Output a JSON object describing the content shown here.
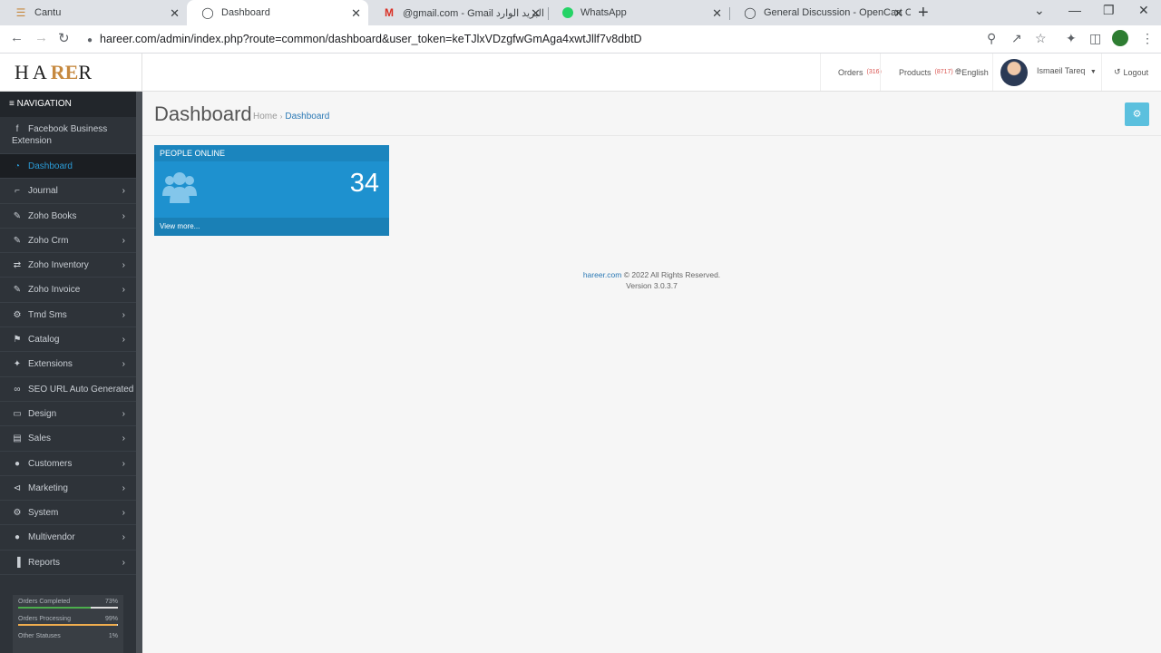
{
  "browser": {
    "tabs": [
      {
        "title": "Cantu",
        "icon": "cantu-favicon"
      },
      {
        "title": "Dashboard",
        "icon": "globe-icon",
        "active": true
      },
      {
        "title": "‎@gmail.com - Gmail البريد الوارد",
        "icon": "gmail-icon"
      },
      {
        "title": "WhatsApp",
        "icon": "whatsapp-icon"
      },
      {
        "title": "General Discussion - OpenCart C",
        "icon": "globe-icon"
      }
    ],
    "url": "hareer.com/admin/index.php?route=common/dashboard&user_token=keTJlxVDzgfwGmAga4xwtJllf7v8dbtD"
  },
  "header": {
    "logo_text_left": "HA",
    "logo_mark": "RE",
    "logo_text_right": "R",
    "orders_label": "Orders",
    "orders_count": "(316)",
    "products_label": "Products",
    "products_count": "(8717)",
    "language": "English",
    "user_name": "Ismaeil Tareq",
    "logout_label": "Logout"
  },
  "sidebar": {
    "heading": "NAVIGATION",
    "items": [
      {
        "label": "Facebook Business Extension",
        "icon": "facebook-icon"
      },
      {
        "label": "Dashboard",
        "icon": "dashboard-icon",
        "active": true
      },
      {
        "label": "Journal",
        "icon": "journal-icon",
        "submenu": true
      },
      {
        "label": "Zoho Books",
        "icon": "brush-icon",
        "submenu": true
      },
      {
        "label": "Zoho Crm",
        "icon": "brush-icon",
        "submenu": true
      },
      {
        "label": "Zoho Inventory",
        "icon": "exchange-icon",
        "submenu": true
      },
      {
        "label": "Zoho Invoice",
        "icon": "brush-icon",
        "submenu": true
      },
      {
        "label": "Tmd Sms",
        "icon": "gear-icon",
        "submenu": true
      },
      {
        "label": "Catalog",
        "icon": "tags-icon",
        "submenu": true
      },
      {
        "label": "Extensions",
        "icon": "puzzle-icon",
        "submenu": true
      },
      {
        "label": "SEO URL Auto Generated",
        "icon": "link-icon"
      },
      {
        "label": "Design",
        "icon": "monitor-icon",
        "submenu": true
      },
      {
        "label": "Sales",
        "icon": "cart-icon",
        "submenu": true
      },
      {
        "label": "Customers",
        "icon": "user-icon",
        "submenu": true
      },
      {
        "label": "Marketing",
        "icon": "share-icon",
        "submenu": true
      },
      {
        "label": "System",
        "icon": "gear-icon",
        "submenu": true
      },
      {
        "label": "Multivendor",
        "icon": "user-icon",
        "submenu": true
      },
      {
        "label": "Reports",
        "icon": "bar-chart-icon",
        "submenu": true
      }
    ],
    "stats": [
      {
        "label": "Orders Completed",
        "value": "73%",
        "fraction": 0.73,
        "color": "#4cae4c"
      },
      {
        "label": "Orders Processing",
        "value": "99%",
        "fraction": 0.99,
        "color": "#f0ad4e"
      },
      {
        "label": "Other Statuses",
        "value": "1%",
        "fraction": 0.01,
        "color": "#d9534f"
      }
    ]
  },
  "main": {
    "title": "Dashboard",
    "breadcrumb": {
      "home": "Home",
      "current": "Dashboard"
    },
    "tile": {
      "heading": "PEOPLE ONLINE",
      "count": "34",
      "more": "View more..."
    },
    "footer": {
      "link": "hareer.com",
      "rights": "© 2022 All Rights Reserved.",
      "version": "Version 3.0.3.7"
    }
  }
}
